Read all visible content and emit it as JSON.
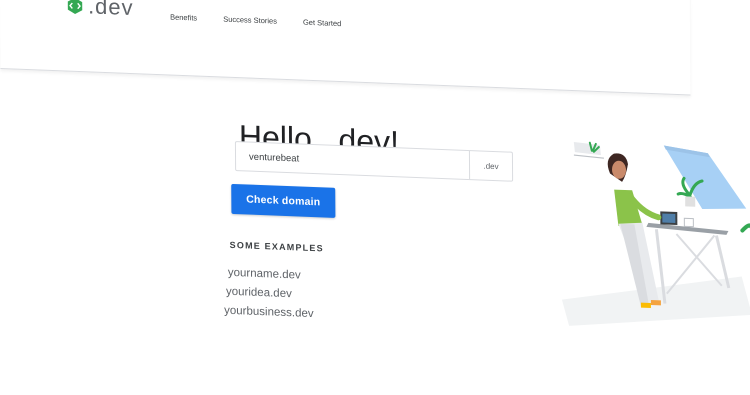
{
  "brand": {
    "name": ".dev",
    "logo_color": "#34a853"
  },
  "nav": {
    "items": [
      "Benefits",
      "Success Stories",
      "Get Started"
    ]
  },
  "hero": {
    "title": "Hello, .dev!",
    "search": {
      "value": "venturebeat",
      "tld": ".dev"
    },
    "button_label": "Check domain",
    "accent": "#1a73e8"
  },
  "examples": {
    "heading": "SOME EXAMPLES",
    "items": [
      "yourname.dev",
      "youridea.dev",
      "yourbusiness.dev"
    ]
  },
  "illustration": {
    "subject": "woman-at-desk-illustration"
  }
}
